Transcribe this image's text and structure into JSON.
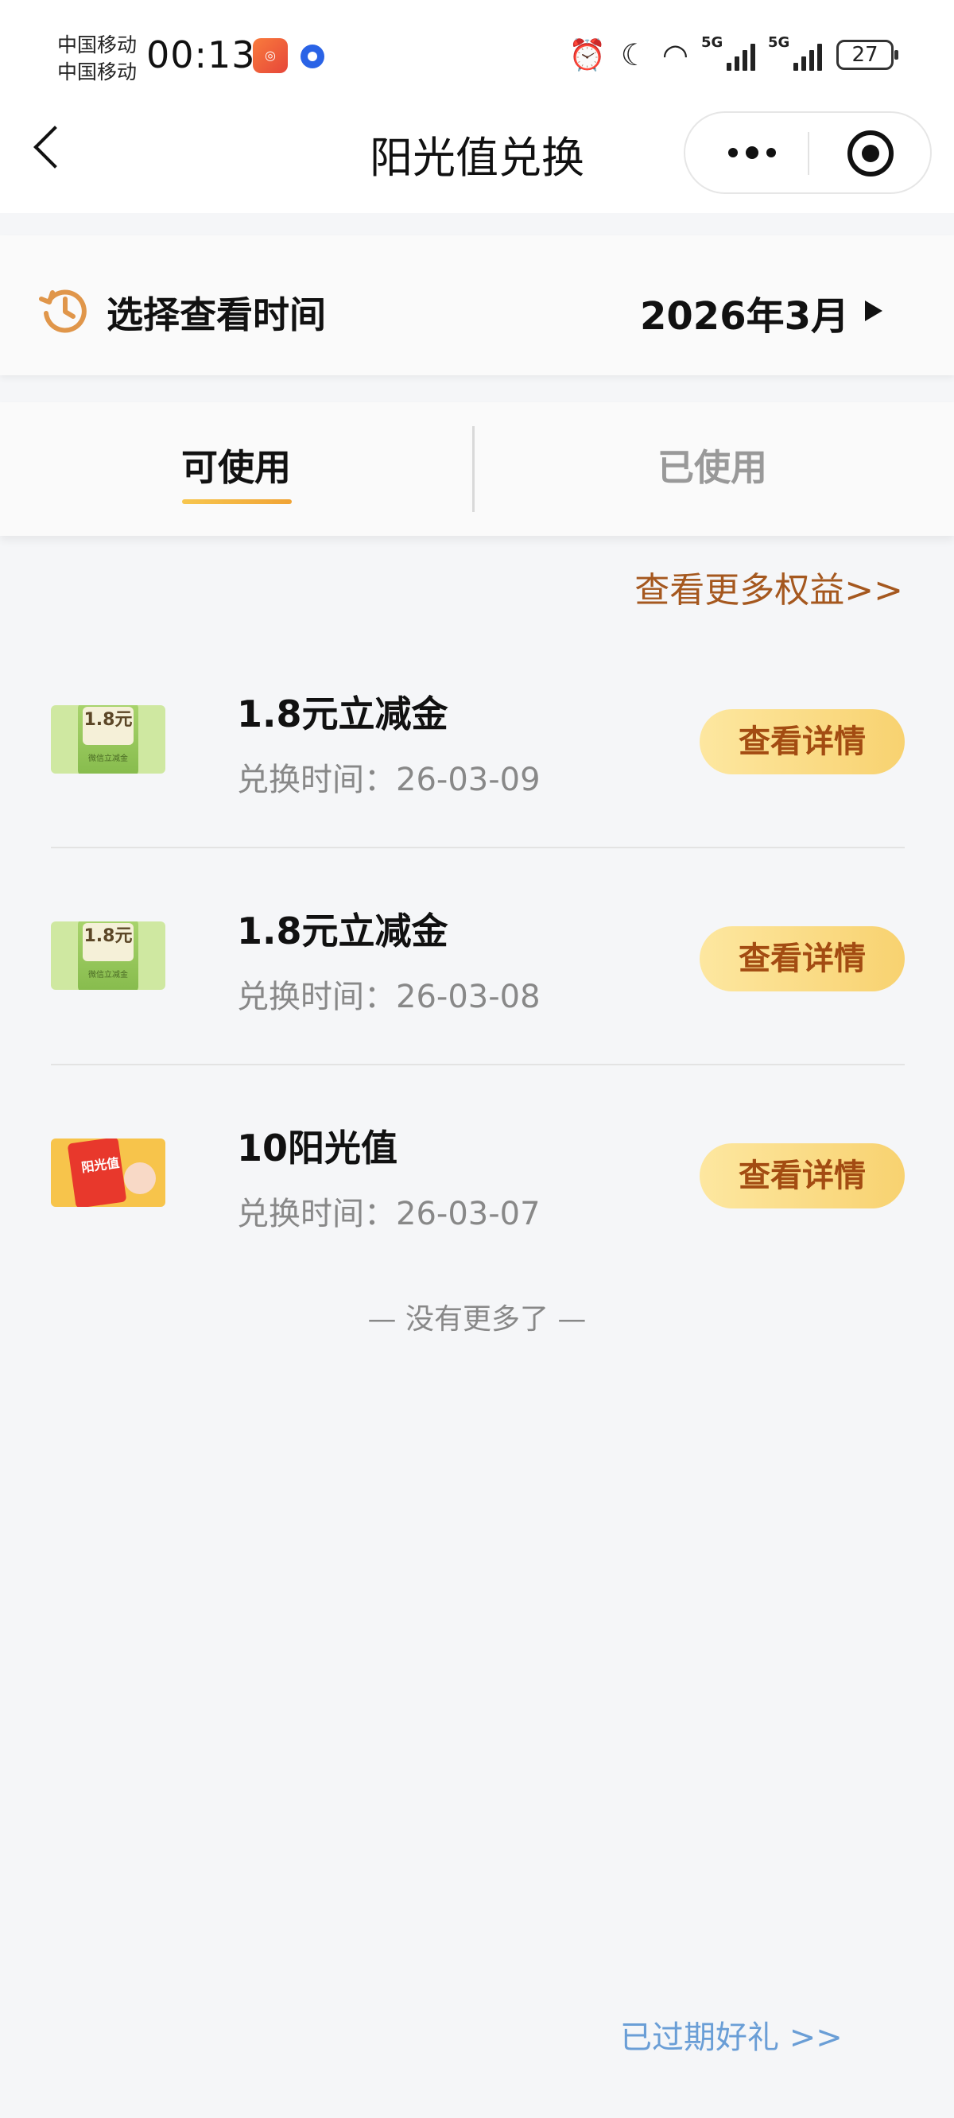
{
  "status_bar": {
    "carrier_1": "中国移动",
    "carrier_2": "中国移动",
    "time": "00:13",
    "network_1": "5G",
    "network_2": "5G",
    "battery": "27"
  },
  "nav": {
    "title": "阳光值兑换"
  },
  "time_selector": {
    "label": "选择查看时间",
    "value": "2026年3月"
  },
  "tabs": [
    {
      "label": "可使用",
      "active": true
    },
    {
      "label": "已使用",
      "active": false
    }
  ],
  "more_benefits_link": "查看更多权益>>",
  "thumb_texts": {
    "green_value": "1.8元",
    "green_caption": "微信立减金",
    "yellow_caption": "阳光值"
  },
  "items": [
    {
      "title": "1.8元立减金",
      "date": "兑换时间：26-03-09",
      "button": "查看详情",
      "thumb": "green"
    },
    {
      "title": "1.8元立减金",
      "date": "兑换时间：26-03-08",
      "button": "查看详情",
      "thumb": "green"
    },
    {
      "title": "10阳光值",
      "date": "兑换时间：26-03-07",
      "button": "查看详情",
      "thumb": "yellow"
    }
  ],
  "end_text": "— 没有更多了 —",
  "expired_link": "已过期好礼 >>",
  "colors": {
    "accent_brown": "#a5581f",
    "button_gradient_start": "#fde7a0",
    "button_gradient_end": "#f8d270",
    "link_blue": "#6a9ed6",
    "tab_underline": "#f0a335"
  }
}
